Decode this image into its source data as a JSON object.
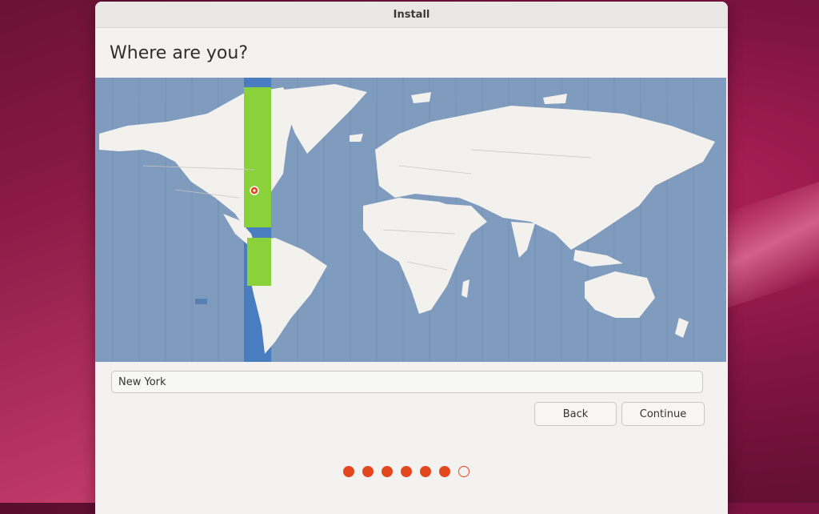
{
  "window": {
    "title": "Install"
  },
  "page": {
    "heading": "Where are you?"
  },
  "map": {
    "selected_city": "New York",
    "selected_zone_color": "#8bd23a",
    "selected_band_color": "#4a7cc0",
    "ocean_color": "#7f9bbd",
    "land_color": "#f2f1ee",
    "marker_icon": "location-pin-icon"
  },
  "location_input": {
    "value": "New York"
  },
  "buttons": {
    "back_label": "Back",
    "continue_label": "Continue"
  },
  "progress": {
    "total_steps": 7,
    "completed_steps": 6,
    "accent_color": "#e2471d"
  }
}
